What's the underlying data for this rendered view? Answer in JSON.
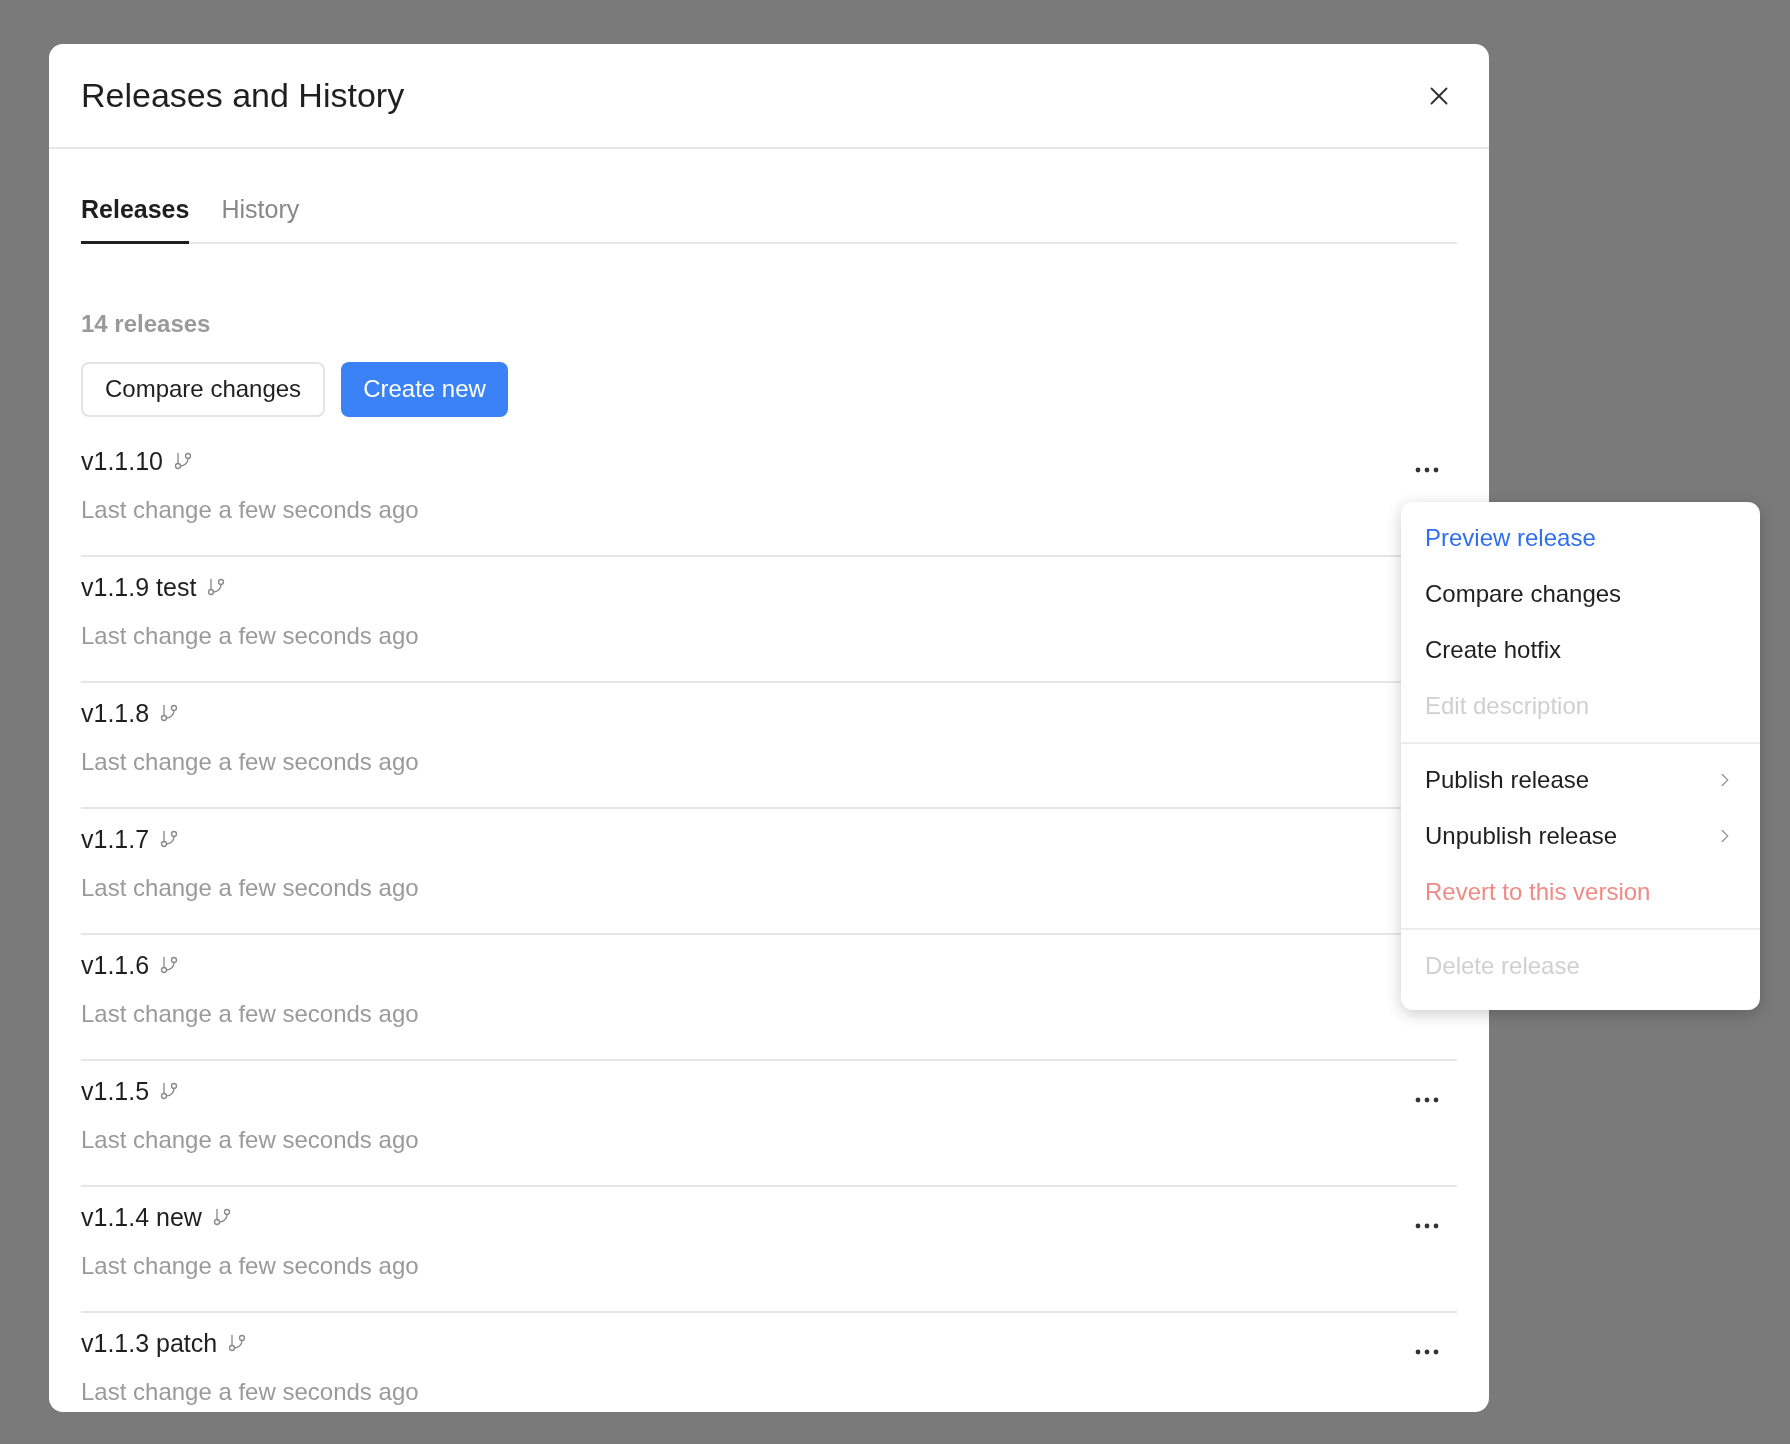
{
  "dialog": {
    "title": "Releases and History"
  },
  "tabs": [
    {
      "label": "Releases",
      "selected": true
    },
    {
      "label": "History",
      "selected": false
    }
  ],
  "count": "14 releases",
  "buttons": [
    {
      "label": "Compare changes",
      "kind": "secondary"
    },
    {
      "label": "Create new",
      "kind": "primary"
    }
  ],
  "releases": [
    {
      "name": "v1.1.10",
      "subtitle": "Last change a few seconds ago"
    },
    {
      "name": "v1.1.9 test",
      "subtitle": "Last change a few seconds ago"
    },
    {
      "name": "v1.1.8",
      "subtitle": "Last change a few seconds ago"
    },
    {
      "name": "v1.1.7",
      "subtitle": "Last change a few seconds ago"
    },
    {
      "name": "v1.1.6",
      "subtitle": "Last change a few seconds ago"
    },
    {
      "name": "v1.1.5",
      "subtitle": "Last change a few seconds ago"
    },
    {
      "name": "v1.1.4 new",
      "subtitle": "Last change a few seconds ago"
    },
    {
      "name": "v1.1.3 patch",
      "subtitle": "Last change a few seconds ago"
    }
  ],
  "menu": {
    "groups": [
      [
        {
          "label": "Preview release",
          "kind": "highlighted"
        },
        {
          "label": "Compare changes",
          "kind": "normal"
        },
        {
          "label": "Create hotfix",
          "kind": "normal"
        },
        {
          "label": "Edit description",
          "kind": "disabled"
        }
      ],
      [
        {
          "label": "Publish release",
          "kind": "submenu"
        },
        {
          "label": "Unpublish release",
          "kind": "submenu"
        },
        {
          "label": "Revert to this version",
          "kind": "danger"
        }
      ],
      [
        {
          "label": "Delete release",
          "kind": "disabled"
        }
      ]
    ]
  }
}
